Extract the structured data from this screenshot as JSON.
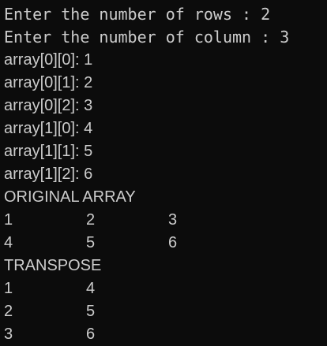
{
  "console": {
    "prompts": [
      "Enter the number of rows : 2",
      "Enter the number of column : 3"
    ],
    "inputs": [
      "array[0][0]: 1",
      "array[0][1]: 2",
      "array[0][2]: 3",
      "array[1][0]: 4",
      "array[1][1]: 5",
      "array[1][2]: 6"
    ],
    "original_heading": "ORIGINAL ARRAY",
    "original_rows": [
      [
        "1",
        "2",
        "3"
      ],
      [
        "4",
        "5",
        "6"
      ]
    ],
    "transpose_heading": "TRANSPOSE",
    "transpose_rows": [
      [
        "1",
        "4"
      ],
      [
        "2",
        "5"
      ],
      [
        "3",
        "6"
      ]
    ]
  }
}
